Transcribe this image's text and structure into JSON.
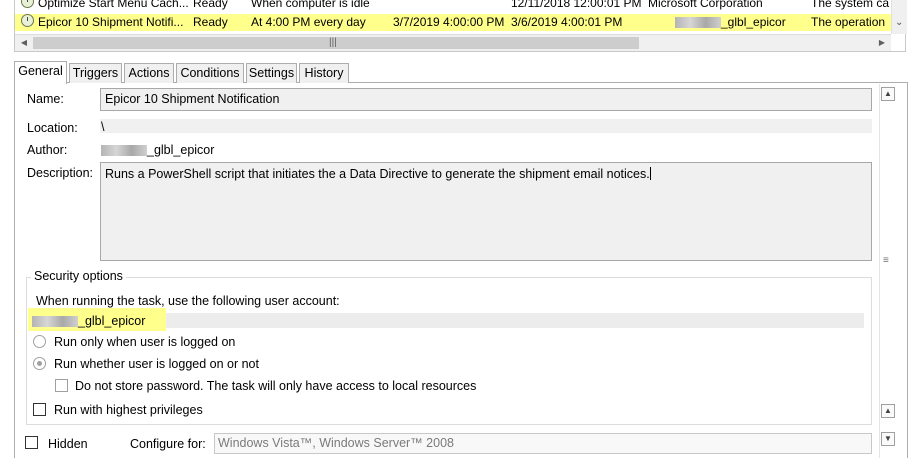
{
  "task_list": {
    "rows": [
      {
        "name": "Optimize Start Menu Cach...",
        "status": "Ready",
        "triggers": "When computer is idle",
        "next_run": "",
        "last_run": "12/11/2018 12:00:01 PM",
        "author": "Microsoft Corporation",
        "description": "The system ca"
      },
      {
        "name": "Epicor 10 Shipment Notifi...",
        "status": "Ready",
        "triggers": "At 4:00 PM every day",
        "next_run": "3/7/2019 4:00:00 PM",
        "last_run": "3/6/2019 4:00:01 PM",
        "author_suffix": "_glbl_epicor",
        "description": "The operation"
      }
    ],
    "scroll_grip": "|||",
    "scroll_down_arrow": "⌄",
    "selection_color": "#ffff8c"
  },
  "tabs": [
    "General",
    "Triggers",
    "Actions",
    "Conditions",
    "Settings",
    "History"
  ],
  "general": {
    "name_label": "Name:",
    "name_value": "Epicor 10 Shipment Notification",
    "location_label": "Location:",
    "location_value": "\\",
    "author_label": "Author:",
    "author_suffix": "_glbl_epicor",
    "description_label": "Description:",
    "description_value": "Runs a PowerShell script that initiates the a Data Directive to generate the shipment email notices.",
    "security": {
      "title": "Security options",
      "run_as_label": "When running the task, use the following user account:",
      "account_suffix": "_glbl_epicor",
      "run_only_logged_on": "Run only when user is logged on",
      "run_whether_logged_on": "Run whether user is logged on or not",
      "do_not_store_password": "Do not store password.  The task will only have access to local resources",
      "run_highest": "Run with highest privileges",
      "selected_option": "run_whether_logged_on"
    },
    "hidden_label": "Hidden",
    "configure_for_label": "Configure for:",
    "configure_for_value": "Windows Vista™, Windows Server™ 2008"
  }
}
